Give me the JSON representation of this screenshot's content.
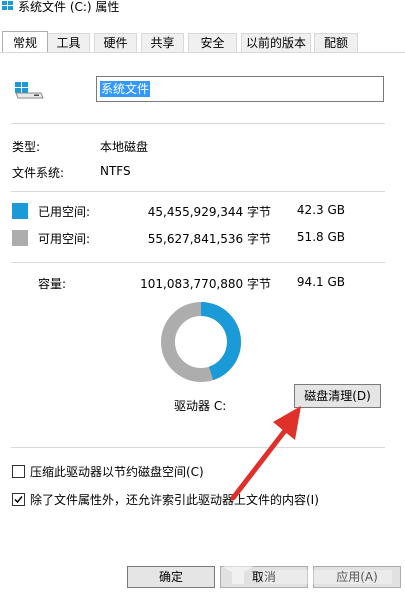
{
  "window": {
    "title": "系统文件 (C:) 属性"
  },
  "tabs": [
    {
      "label": "常规"
    },
    {
      "label": "工具"
    },
    {
      "label": "硬件"
    },
    {
      "label": "共享"
    },
    {
      "label": "安全"
    },
    {
      "label": "以前的版本"
    },
    {
      "label": "配额"
    }
  ],
  "general": {
    "drive_name": "系统文件",
    "type_label": "类型:",
    "type_value": "本地磁盘",
    "fs_label": "文件系统:",
    "fs_value": "NTFS",
    "used": {
      "label": "已用空间:",
      "bytes": "45,455,929,344 字节",
      "size": "42.3 GB",
      "color": "#1a9ad6"
    },
    "free": {
      "label": "可用空间:",
      "bytes": "55,627,841,536 字节",
      "size": "51.8 GB",
      "color": "#adadad"
    },
    "capacity": {
      "label": "容量:",
      "bytes": "101,083,770,880 字节",
      "size": "94.1 GB"
    },
    "drive_caption": "驱动器 C:",
    "cleanup_button": "磁盘清理(D)",
    "compress_option": {
      "label": "压缩此驱动器以节约磁盘空间(C)",
      "checked": false
    },
    "index_option": {
      "label": "除了文件属性外，还允许索引此驱动器上文件的内容(I)",
      "checked": true
    }
  },
  "footer": {
    "ok": "确定",
    "cancel": "取消",
    "apply": "应用(A)"
  },
  "icons": {
    "app": "windows-logo-icon",
    "drive": "hard-drive-icon",
    "annotation": "red-arrow-annotation",
    "watermark": "site-watermark"
  }
}
